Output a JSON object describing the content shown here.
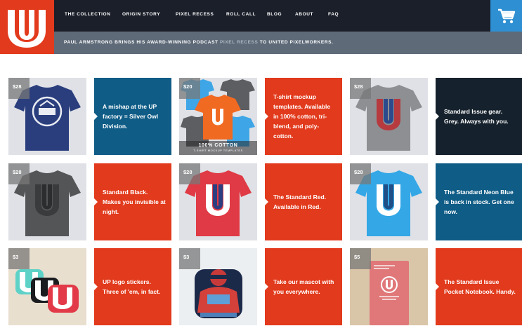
{
  "colors": {
    "brand_red": "#e23a1c",
    "nav_bg": "#1b1f2a",
    "banner_bg": "#5e6a78",
    "cart_bg": "#2e8fd2",
    "panel_blue": "#0f5c86",
    "panel_navy": "#15212c"
  },
  "logo": {
    "icon": "unitedpixelworkers-u-logo"
  },
  "nav": {
    "items": [
      {
        "label": "THE COLLECTION"
      },
      {
        "label": "ORIGIN STORY"
      },
      {
        "label": "PIXEL RECESS"
      },
      {
        "label": "ROLL CALL"
      },
      {
        "label": "BLOG"
      },
      {
        "label": "ABOUT"
      },
      {
        "label": "FAQ"
      }
    ],
    "cart_icon": "cart-icon"
  },
  "banner": {
    "text_before": "PAUL ARMSTRONG BRINGS HIS AWARD-WINNING PODCAST ",
    "link": "PIXEL RECESS",
    "text_after": " TO UNITED PIXELWORKERS."
  },
  "products": [
    {
      "price": "$28",
      "image": "navy-tshirt-silver-owl",
      "tile_text": "",
      "tile_subtext": "",
      "description": "A mishap at the UP factory = Silver Owl Division.",
      "panel": "blue"
    },
    {
      "price": "$20",
      "image": "tshirt-mockup-collage",
      "tile_text": "100% COTTON",
      "tile_subtext": "T-SHIRT MOCKUP TEMPLATES",
      "description": "T-shirt mockup templates. Available in 100% cotton, tri-blend, and poly-cotton.",
      "panel": "red"
    },
    {
      "price": "$28",
      "image": "grey-tshirt",
      "tile_text": "",
      "tile_subtext": "",
      "description": "Standard Issue gear. Grey. Always with you.",
      "panel": "navy"
    },
    {
      "price": "$28",
      "image": "black-tshirt",
      "tile_text": "",
      "tile_subtext": "",
      "description": "Standard Black. Makes you invisible at night.",
      "panel": "red"
    },
    {
      "price": "$28",
      "image": "red-tshirt",
      "tile_text": "",
      "tile_subtext": "",
      "description": "The Standard Red. Available in Red.",
      "panel": "red"
    },
    {
      "price": "$28",
      "image": "neon-blue-tshirt",
      "tile_text": "",
      "tile_subtext": "",
      "description": "The Standard Neon Blue is back in stock. Get one now.",
      "panel": "blue"
    },
    {
      "price": "$3",
      "image": "up-logo-stickers",
      "tile_text": "",
      "tile_subtext": "",
      "description": "UP logo stickers. Three of 'em, in fact.",
      "panel": "red"
    },
    {
      "price": "$3",
      "image": "mascot-sticker",
      "tile_text": "",
      "tile_subtext": "",
      "description": "Take our mascot with you everywhere.",
      "panel": "red"
    },
    {
      "price": "$5",
      "image": "pocket-notebook",
      "tile_text": "",
      "tile_subtext": "",
      "description": "The Standard Issue Pocket Notebook. Handy.",
      "panel": "red"
    }
  ]
}
